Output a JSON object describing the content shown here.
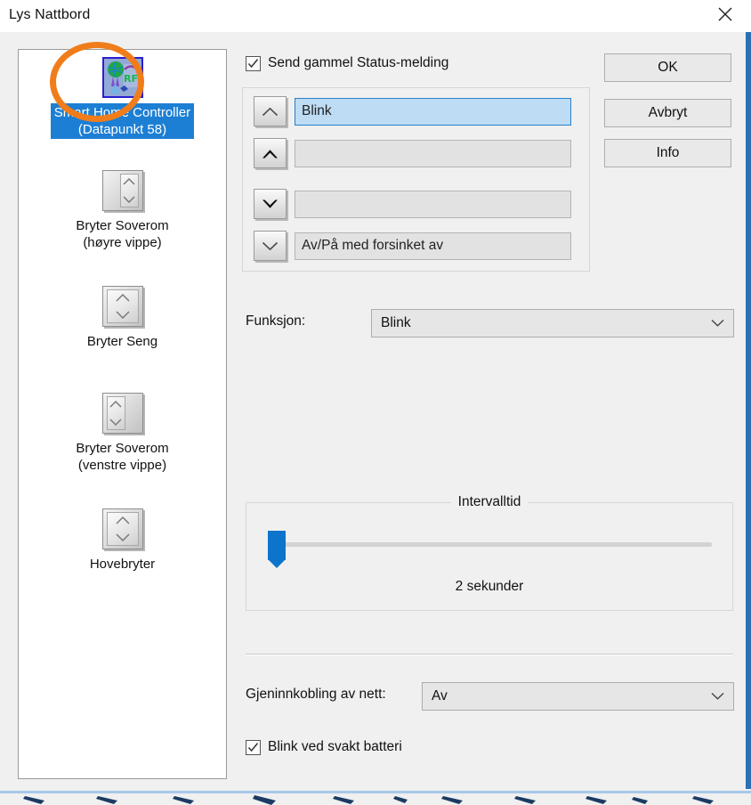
{
  "window": {
    "title": "Lys Nattbord",
    "close_icon": "close-icon"
  },
  "device_list": {
    "items": [
      {
        "label": "Smart Home Controller\n(Datapunkt 58)",
        "icon": "smart-home-controller-icon",
        "selected": true,
        "highlighted": true
      },
      {
        "label": "Bryter Soverom\n(høyre vippe)",
        "icon": "rocker-switch-right-icon",
        "selected": false,
        "highlighted": false
      },
      {
        "label": "Bryter Seng",
        "icon": "rocker-switch-full-icon",
        "selected": false,
        "highlighted": false
      },
      {
        "label": "Bryter Soverom\n(venstre vippe)",
        "icon": "rocker-switch-left-icon",
        "selected": false,
        "highlighted": false
      },
      {
        "label": "Hovebryter",
        "icon": "rocker-switch-full-icon",
        "selected": false,
        "highlighted": false
      }
    ]
  },
  "status_checkbox": {
    "label": "Send gammel Status-melding",
    "checked": true
  },
  "command_rows": [
    {
      "button_icon": "chevron-up-thin-icon",
      "value": "Blink",
      "active": true
    },
    {
      "button_icon": "chevron-up-bold-icon",
      "value": "",
      "active": false
    },
    {
      "button_icon": "chevron-down-bold-icon",
      "value": "",
      "active": false
    },
    {
      "button_icon": "chevron-down-thin-icon",
      "value": "Av/På med forsinket av",
      "active": false
    }
  ],
  "action_buttons": [
    {
      "label": "OK",
      "name": "ok-button"
    },
    {
      "label": "Avbryt",
      "name": "cancel-button"
    },
    {
      "label": "Info",
      "name": "info-button"
    }
  ],
  "function_field": {
    "label": "Funksjon:",
    "value": "Blink",
    "chevron_icon": "chevron-down-icon"
  },
  "interval_group": {
    "legend": "Intervalltid",
    "value_text": "2 sekunder",
    "slider_percent": 2
  },
  "reconnect_field": {
    "label": "Gjeninnkobling av nett:",
    "value": "Av",
    "chevron_icon": "chevron-down-icon"
  },
  "battery_checkbox": {
    "label": "Blink ved svakt batteri",
    "checked": true
  },
  "colors": {
    "accent_blue": "#1d7fd4",
    "slider_blue": "#0d74cc",
    "highlight_ring_orange": "#f07d1a",
    "active_field_blue": "#bedcf4",
    "window_bg": "#f0f0f0"
  }
}
